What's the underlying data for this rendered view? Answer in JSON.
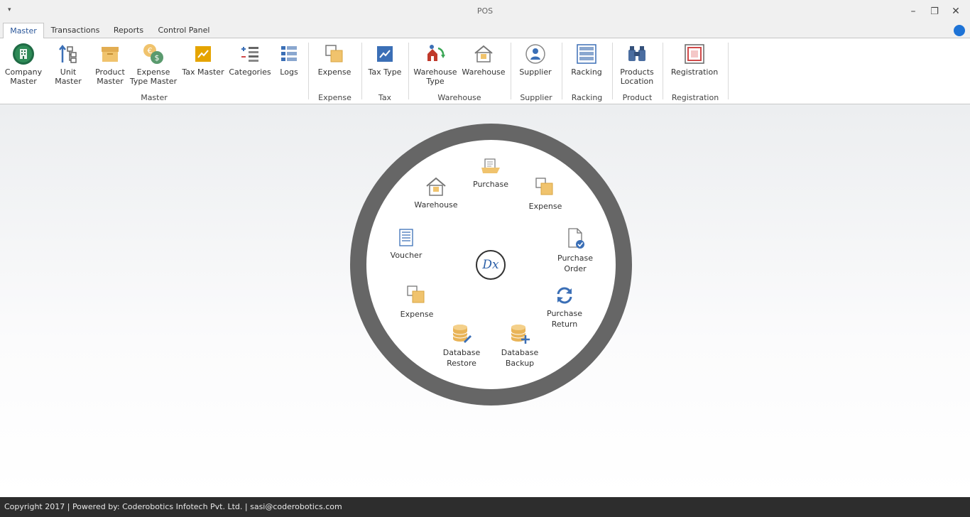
{
  "window": {
    "title": "POS",
    "qa_glyph": "▾",
    "minimize": "–",
    "restore": "❐",
    "close": "✕"
  },
  "tabs": [
    {
      "label": "Master",
      "active": true
    },
    {
      "label": "Transactions"
    },
    {
      "label": "Reports"
    },
    {
      "label": "Control Panel"
    }
  ],
  "ribbon": {
    "buttons": {
      "company_master": "Company Master",
      "unit_master": "Unit Master",
      "product_master": "Product Master",
      "expense_type_master": "Expense Type Master",
      "tax_master": "Tax Master",
      "categories": "Categories",
      "logs": "Logs",
      "expense": "Expense",
      "tax_type": "Tax Type",
      "warehouse_type": "Warehouse Type",
      "warehouse": "Warehouse",
      "supplier": "Supplier",
      "racking": "Racking",
      "products_location": "Products Location",
      "registration": "Registration"
    },
    "groups": {
      "master": "Master",
      "expense": "Expense",
      "tax": "Tax",
      "warehouse": "Warehouse",
      "supplier": "Supplier",
      "racking": "Racking",
      "product": "Product",
      "registration": "Registration"
    }
  },
  "radial_menu": {
    "center_logo": "Dx",
    "items": {
      "purchase": "Purchase",
      "warehouse": "Warehouse",
      "expense_top": "Expense",
      "purchase_order": "Purchase Order",
      "voucher": "Voucher",
      "purchase_return": "Purchase Return",
      "expense_bottom": "Expense",
      "database_restore": "Database Restore",
      "database_backup": "Database Backup"
    }
  },
  "footer": {
    "text": "Copyright 2017 | Powered by: Coderobotics Infotech Pvt. Ltd. | sasi@coderobotics.com"
  },
  "colors": {
    "accent": "#2b579a",
    "help_dot": "#1e73d6",
    "ring": "#666666",
    "footer_bg": "#2d2d2d",
    "folder": "#f0c36d"
  }
}
